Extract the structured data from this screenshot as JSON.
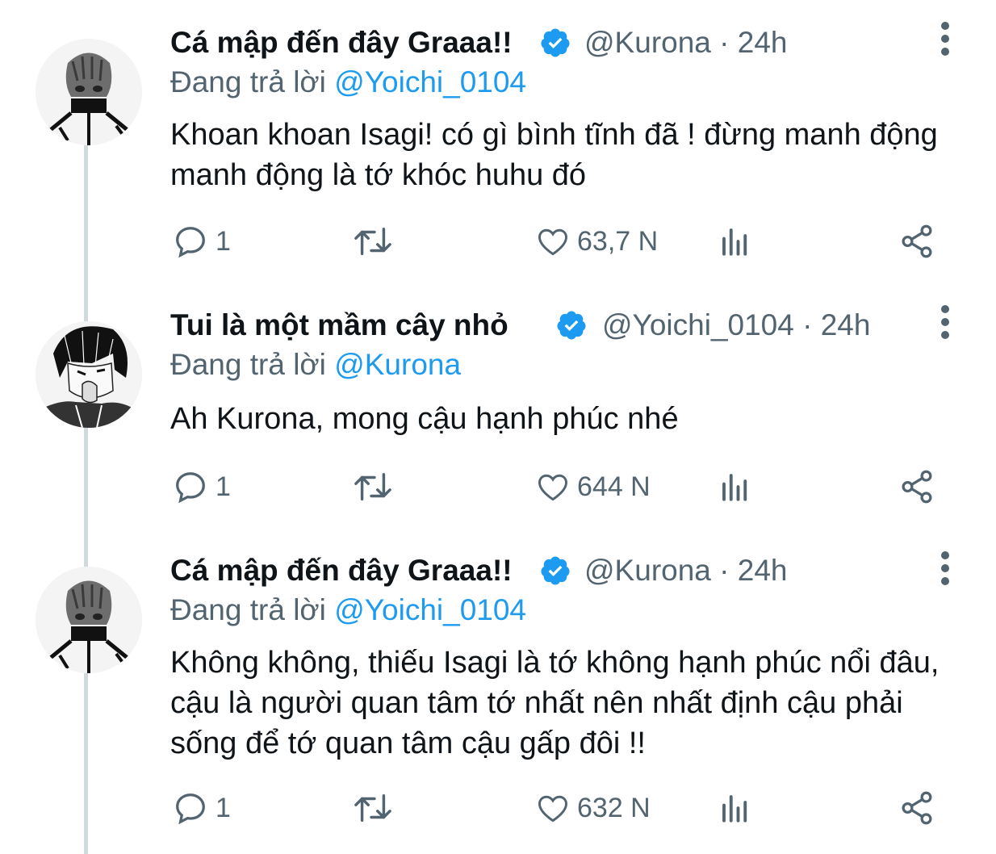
{
  "tweets": [
    {
      "display_name": "Cá mập đến đây Graaa!!",
      "handle": "@Kurona",
      "time": "24h",
      "replying_prefix": "Đang trả lời",
      "replying_to": "@Yoichi_0104",
      "text": "Khoan khoan Isagi! có gì bình tĩnh đã ! đừng manh động manh động là tớ khóc huhu đó",
      "replies": "1",
      "likes": "63,7 N",
      "avatar": "kurona-avatar"
    },
    {
      "display_name": "Tui là một mầm cây nhỏ",
      "handle": "@Yoichi_0104",
      "time": "24h",
      "replying_prefix": "Đang trả lời",
      "replying_to": "@Kurona",
      "text": "Ah Kurona, mong cậu hạnh phúc nhé",
      "replies": "1",
      "likes": "644 N",
      "avatar": "isagi-avatar"
    },
    {
      "display_name": "Cá mập đến đây Graaa!!",
      "handle": "@Kurona",
      "time": "24h",
      "replying_prefix": "Đang trả lời",
      "replying_to": "@Yoichi_0104",
      "text": "Không không, thiếu Isagi là tớ không hạnh phúc nổi đâu, cậu là người quan tâm tớ nhất nên nhất định cậu phải sống để tớ quan tâm cậu gấp đôi !!",
      "replies": "1",
      "likes": "632 N",
      "avatar": "kurona-avatar"
    }
  ],
  "icons": {
    "verified": "verified-badge-icon",
    "more": "more-options-icon",
    "reply": "reply-icon",
    "retweet": "retweet-icon",
    "like": "like-icon",
    "views": "views-icon",
    "share": "share-icon"
  },
  "colors": {
    "verified": "#1d9bf0",
    "mention": "#1d9bf0",
    "secondary_text": "#536471",
    "primary_text": "#0f1419",
    "thread_line": "#cfd9de"
  }
}
